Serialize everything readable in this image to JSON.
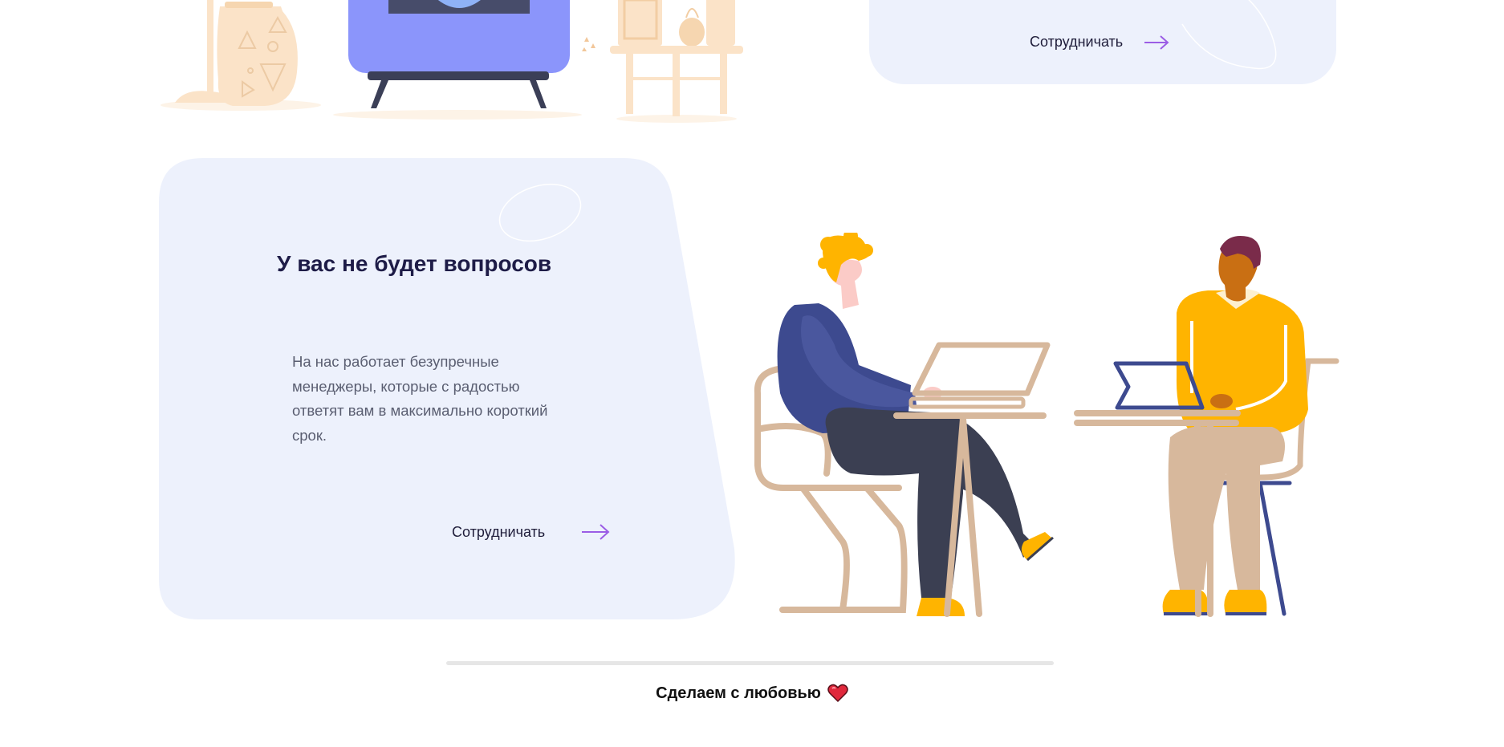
{
  "top_card": {
    "cta_label": "Сотрудничать"
  },
  "main_card": {
    "title": "У вас не будет вопросов",
    "text": "На нас работает безупречные менеджеры, которые с радостью ответят вам в максимально короткий срок.",
    "cta_label": "Сотрудничать"
  },
  "footer": {
    "text": "Сделаем с любовью",
    "icon": "heart-icon"
  },
  "colors": {
    "card_bg": "#edf1fc",
    "title": "#1e1c47",
    "accent_arrow": "#9b5de5",
    "tv_purple": "#8b95fb",
    "sweater_blue": "#3d4a8f",
    "sweater_yellow": "#ffb400",
    "chair_beige": "#d7b89c"
  }
}
